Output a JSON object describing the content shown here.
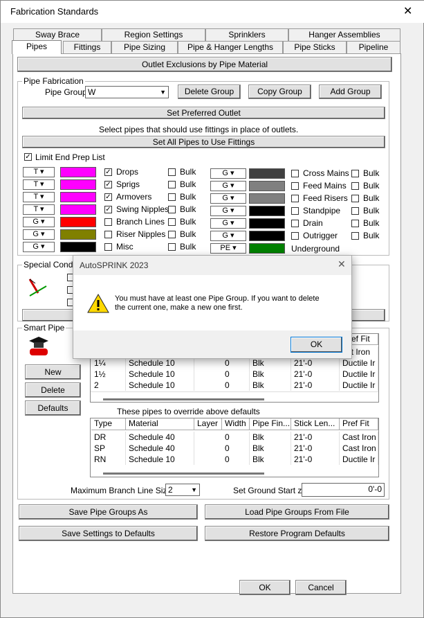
{
  "window": {
    "title": "Fabrication Standards",
    "close": "✕"
  },
  "tabs_row1": [
    "Sway Brace",
    "Region Settings",
    "Sprinklers",
    "Hanger Assemblies"
  ],
  "tabs_row2": [
    "Pipes",
    "Fittings",
    "Pipe Sizing",
    "Pipe & Hanger Lengths",
    "Pipe Sticks",
    "Pipeline"
  ],
  "outlet_exclusions": "Outlet Exclusions by Pipe Material",
  "pipe_fab": {
    "label": "Pipe Fabrication",
    "pipe_group_label": "Pipe Group",
    "pipe_group_value": "W",
    "delete_group": "Delete Group",
    "copy_group": "Copy Group",
    "add_group": "Add Group",
    "set_preferred": "Set Preferred Outlet",
    "select_note": "Select pipes that should use fittings in place of outlets.",
    "set_all": "Set All Pipes to Use Fittings",
    "limit_end_prep": "Limit End Prep List"
  },
  "left_items": [
    {
      "dd": "T",
      "color": "#ff00ff",
      "name": "Drops",
      "checked": true,
      "bulk": "Bulk"
    },
    {
      "dd": "T",
      "color": "#ff00ff",
      "name": "Sprigs",
      "checked": true,
      "bulk": "Bulk"
    },
    {
      "dd": "T",
      "color": "#ff00ff",
      "name": "Armovers",
      "checked": true,
      "bulk": "Bulk"
    },
    {
      "dd": "T",
      "color": "#ff00ff",
      "name": "Swing Nipples",
      "checked": true,
      "bulk": "Bulk"
    },
    {
      "dd": "G",
      "color": "#ff0000",
      "name": "Branch Lines",
      "checked": false,
      "bulk": "Bulk"
    },
    {
      "dd": "G",
      "color": "#808000",
      "name": "Riser Nipples",
      "checked": false,
      "bulk": "Bulk"
    },
    {
      "dd": "G",
      "color": "#000000",
      "name": "Misc",
      "checked": false,
      "bulk": "Bulk"
    }
  ],
  "right_items": [
    {
      "dd": "G",
      "color": "#404040",
      "name": "Cross Mains",
      "bulk": "Bulk"
    },
    {
      "dd": "G",
      "color": "#808080",
      "name": "Feed Mains",
      "bulk": "Bulk"
    },
    {
      "dd": "G",
      "color": "#808080",
      "name": "Feed Risers",
      "bulk": "Bulk"
    },
    {
      "dd": "G",
      "color": "#000000",
      "name": "Standpipe",
      "bulk": "Bulk"
    },
    {
      "dd": "G",
      "color": "#000000",
      "name": "Drain",
      "bulk": "Bulk"
    },
    {
      "dd": "G",
      "color": "#000000",
      "name": "Outrigger",
      "bulk": "Bulk"
    },
    {
      "dd": "PE",
      "color": "#008000",
      "name": "Underground",
      "bulk": ""
    }
  ],
  "special_cond": {
    "label": "Special Conditi"
  },
  "smart_pipe": {
    "label": "Smart Pipe",
    "new": "New",
    "delete": "Delete",
    "defaults": "Defaults",
    "visible_header": "Pref Fit",
    "top_rows": [
      [
        "",
        "",
        "",
        "",
        "",
        "",
        "ast Iron"
      ],
      [
        "1¼",
        "Schedule 10",
        "",
        "0",
        "Blk",
        "21'-0",
        "Ductile Ir"
      ],
      [
        "1½",
        "Schedule 10",
        "",
        "0",
        "Blk",
        "21'-0",
        "Ductile Ir"
      ],
      [
        "2",
        "Schedule 10",
        "",
        "0",
        "Blk",
        "21'-0",
        "Ductile Ir"
      ]
    ],
    "override_label": "These pipes to override above defaults",
    "headers": [
      "Type",
      "Material",
      "Layer",
      "Width",
      "Pipe Fin...",
      "Stick Len...",
      "Pref Fit"
    ],
    "rows": [
      [
        "DR",
        "Schedule 40",
        "",
        "0",
        "Blk",
        "21'-0",
        "Cast Iron"
      ],
      [
        "SP",
        "Schedule 40",
        "",
        "0",
        "Blk",
        "21'-0",
        "Cast Iron"
      ],
      [
        "RN",
        "Schedule 10",
        "",
        "0",
        "Blk",
        "21'-0",
        "Ductile Ir"
      ]
    ]
  },
  "max_branch_label": "Maximum Branch Line Size:",
  "max_branch_value": "2",
  "ground_start_label": "Set Ground Start z:",
  "ground_start_value": "0'-0",
  "buttons": {
    "save_groups": "Save Pipe Groups As",
    "load_groups": "Load Pipe Groups From File",
    "save_defaults": "Save Settings to Defaults",
    "restore_defaults": "Restore Program Defaults",
    "ok": "OK",
    "cancel": "Cancel"
  },
  "dialog": {
    "title": "AutoSPRINK 2023",
    "message_line1": "You must have at least one Pipe Group. If you want to delete",
    "message_line2": "the current one, make a new one first.",
    "ok": "OK",
    "close": "✕"
  }
}
